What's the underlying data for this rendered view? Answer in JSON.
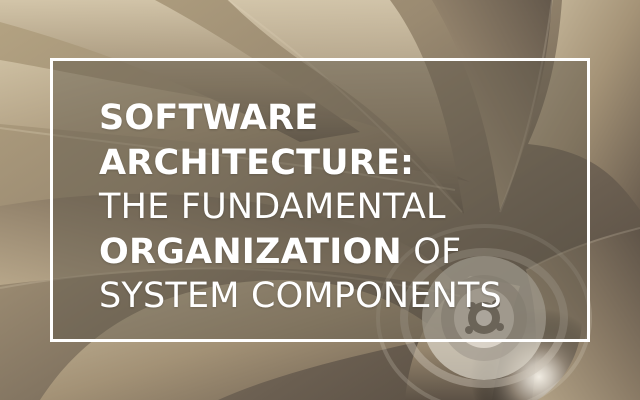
{
  "headline": {
    "line1": "SOFTWARE",
    "line2": "ARCHITECTURE:",
    "line3": "THE FUNDAMENTAL",
    "line4_bold": "ORGANIZATION",
    "line4_light": " OF",
    "line5": "SYSTEM COMPONENTS"
  },
  "colors": {
    "text": "#ffffff",
    "frame": "#ffffff",
    "overlay": "#5c5449"
  }
}
